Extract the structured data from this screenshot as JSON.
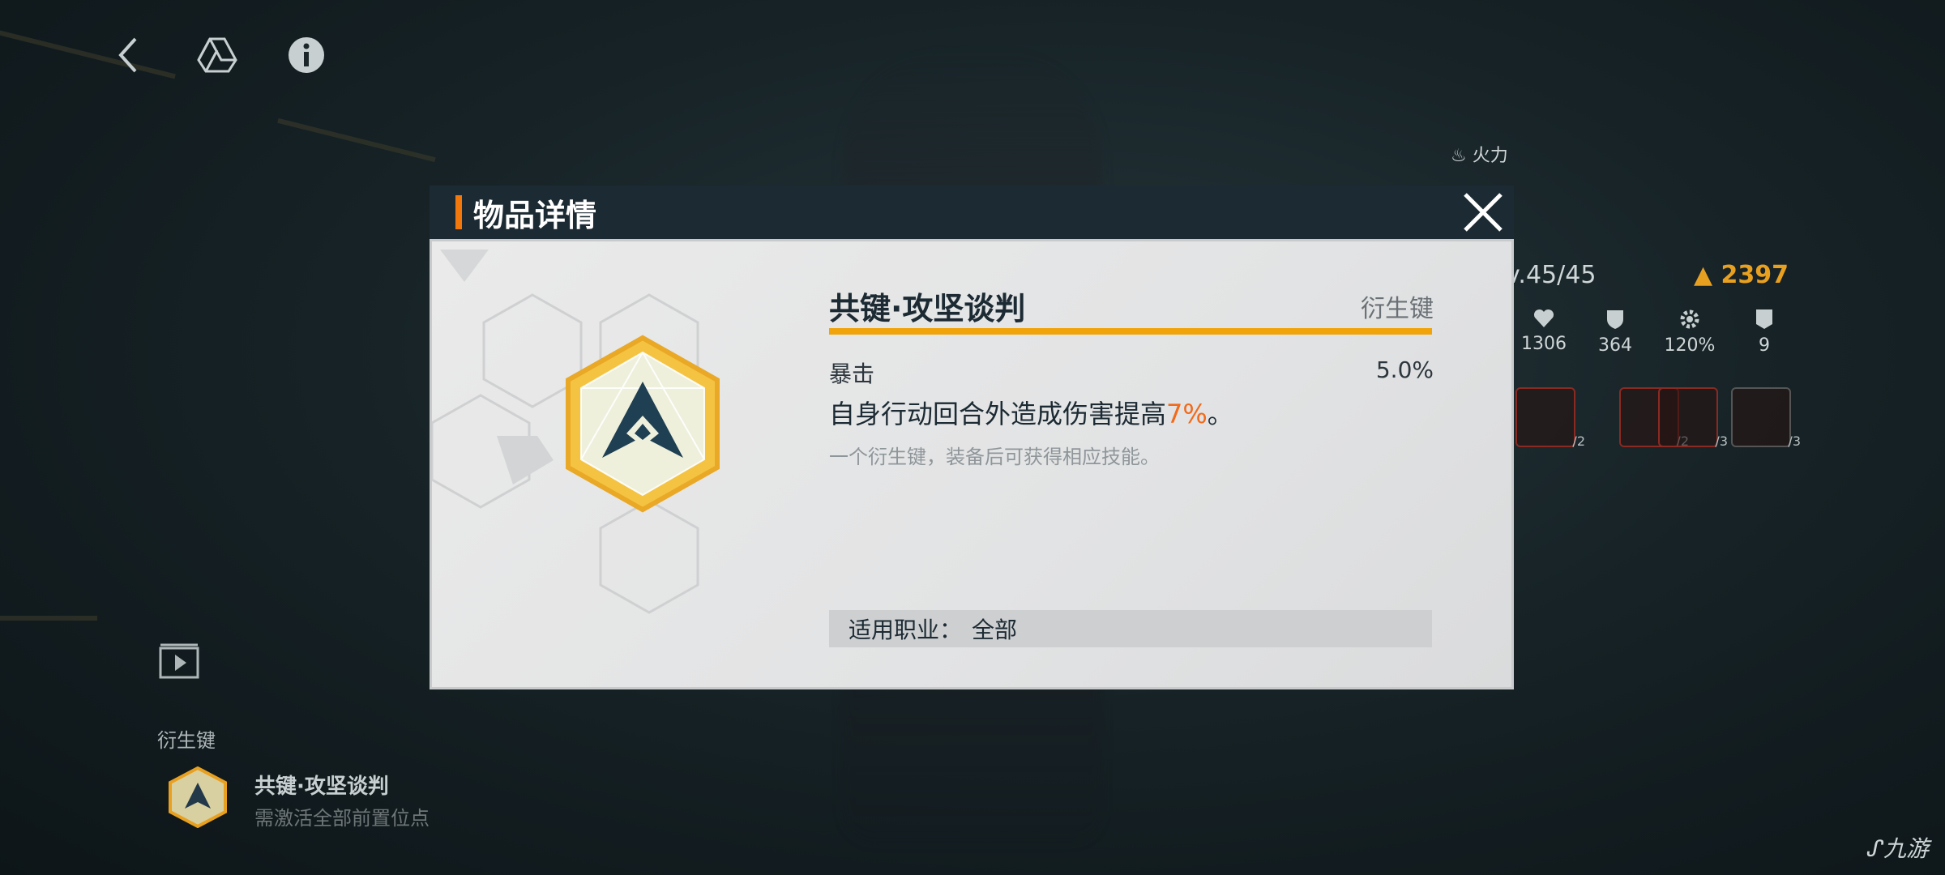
{
  "top_bar": {
    "back_icon": "chevron-left-icon",
    "drive_icon": "triangle-logo-icon",
    "info_icon": "info-icon"
  },
  "character_panel": {
    "class_label": "火力",
    "level": "v.45/45",
    "power": "2397",
    "stats": [
      "1306",
      "364",
      "120%",
      "9"
    ],
    "skill_counts": [
      "/2",
      "/2",
      "/3",
      "/3"
    ]
  },
  "left_panel": {
    "section_label": "衍生键",
    "item_name": "共键·攻坚谈判",
    "item_hint": "需激活全部前置位点"
  },
  "modal": {
    "title": "物品详情",
    "item_name": "共键·攻坚谈判",
    "item_type": "衍生键",
    "stat_name": "暴击",
    "stat_value": "5.0%",
    "effect_prefix": "自身行动回合外造成伤害提高",
    "effect_highlight": "7%",
    "effect_suffix": "。",
    "description": "一个衍生键，装备后可获得相应技能。",
    "job_label": "适用职业：",
    "job_value": "全部"
  },
  "watermark": "九游",
  "colors": {
    "accent_orange": "#f2780c",
    "name_underline": "#f0a40a",
    "highlight": "#f26a1a",
    "header_bg": "#1c2b33",
    "power_gold": "#e8a020"
  }
}
